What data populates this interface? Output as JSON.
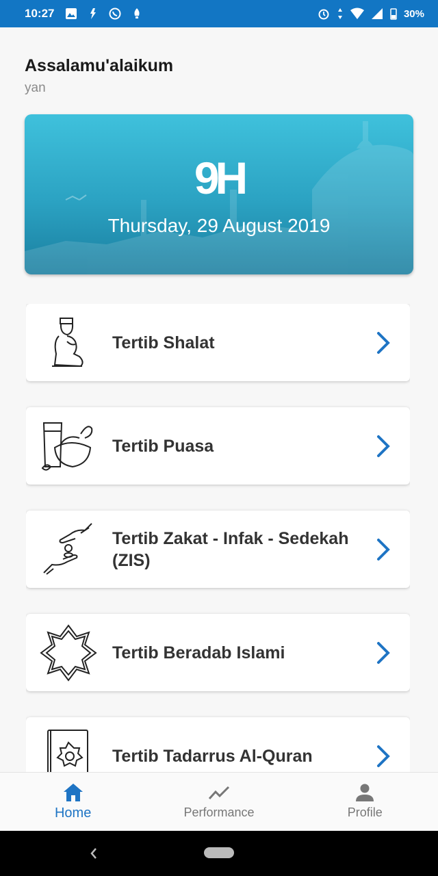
{
  "status_bar": {
    "time": "10:27",
    "battery": "30%"
  },
  "header": {
    "greeting": "Assalamu'alaikum",
    "username": "yan"
  },
  "banner": {
    "logo_text": "9H",
    "date": "Thursday, 29 August 2019"
  },
  "menu": {
    "items": [
      {
        "label": "Tertib Shalat",
        "icon": "prayer-icon"
      },
      {
        "label": "Tertib Puasa",
        "icon": "fasting-food-icon"
      },
      {
        "label": "Tertib Zakat - Infak - Sedekah (ZIS)",
        "icon": "giving-hands-icon"
      },
      {
        "label": "Tertib Beradab Islami",
        "icon": "islamic-star-icon"
      },
      {
        "label": "Tertib Tadarrus Al-Quran",
        "icon": "quran-book-icon"
      }
    ]
  },
  "bottom_nav": {
    "home": "Home",
    "performance": "Performance",
    "profile": "Profile"
  },
  "colors": {
    "status_bar": "#1276c4",
    "accent": "#1e74c4",
    "chevron": "#1e74c4"
  }
}
